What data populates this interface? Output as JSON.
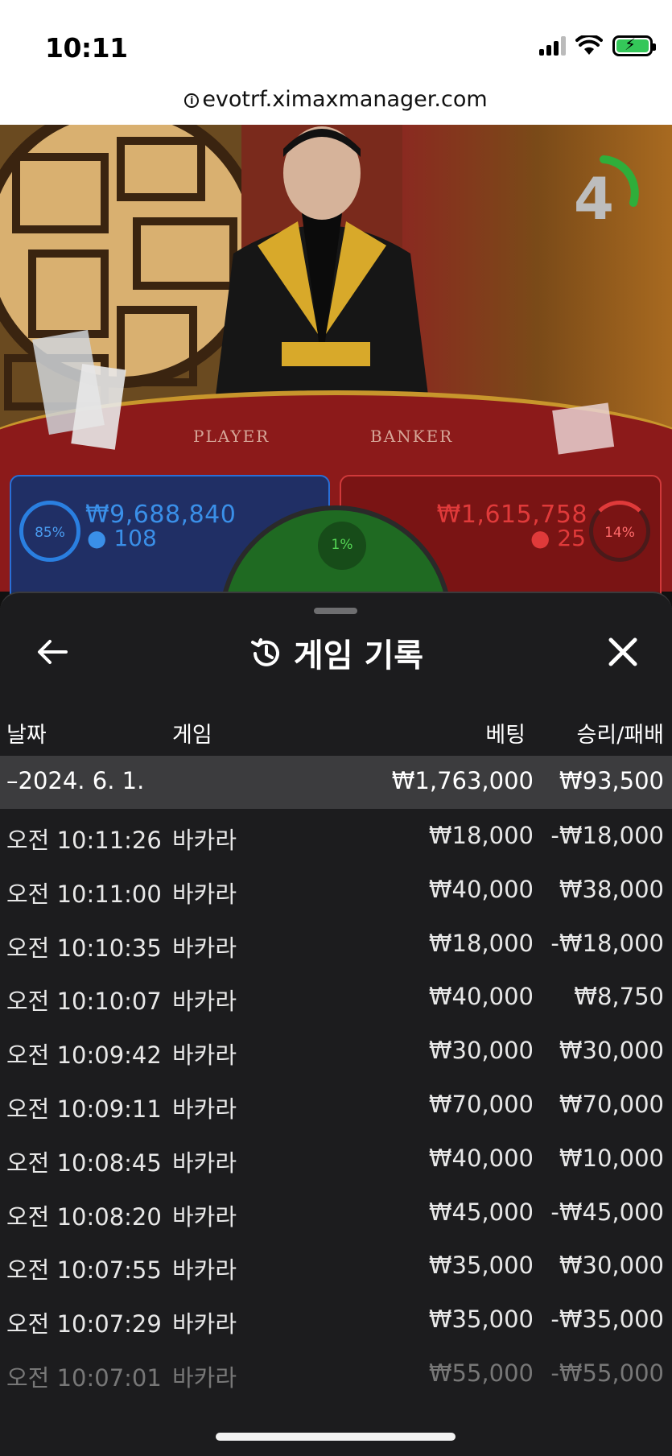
{
  "status_bar": {
    "time": "10:11"
  },
  "browser": {
    "url": "evotrf.ximaxmanager.com"
  },
  "video": {
    "countdown": "4",
    "table_labels": {
      "player": "PLAYER",
      "banker": "BANKER"
    },
    "player_bet": {
      "percent": "85%",
      "amount": "₩9,688,840",
      "players": "108"
    },
    "banker_bet": {
      "percent": "14%",
      "amount": "₩1,615,758",
      "players": "25"
    },
    "tie_bet": {
      "percent": "1%"
    }
  },
  "history": {
    "title": "게임 기록",
    "columns": {
      "date": "날짜",
      "game": "게임",
      "bet": "베팅",
      "win_loss": "승리/패배"
    },
    "summary": {
      "date": "–2024. 6. 1.",
      "bet": "₩1,763,000",
      "win_loss": "₩93,500"
    },
    "rows": [
      {
        "time": "오전 10:11:26",
        "game": "바카라",
        "bet": "₩18,000",
        "win_loss": "-₩18,000"
      },
      {
        "time": "오전 10:11:00",
        "game": "바카라",
        "bet": "₩40,000",
        "win_loss": "₩38,000"
      },
      {
        "time": "오전 10:10:35",
        "game": "바카라",
        "bet": "₩18,000",
        "win_loss": "-₩18,000"
      },
      {
        "time": "오전 10:10:07",
        "game": "바카라",
        "bet": "₩40,000",
        "win_loss": "₩8,750"
      },
      {
        "time": "오전 10:09:42",
        "game": "바카라",
        "bet": "₩30,000",
        "win_loss": "₩30,000"
      },
      {
        "time": "오전 10:09:11",
        "game": "바카라",
        "bet": "₩70,000",
        "win_loss": "₩70,000"
      },
      {
        "time": "오전 10:08:45",
        "game": "바카라",
        "bet": "₩40,000",
        "win_loss": "₩10,000"
      },
      {
        "time": "오전 10:08:20",
        "game": "바카라",
        "bet": "₩45,000",
        "win_loss": "-₩45,000"
      },
      {
        "time": "오전 10:07:55",
        "game": "바카라",
        "bet": "₩35,000",
        "win_loss": "₩30,000"
      },
      {
        "time": "오전 10:07:29",
        "game": "바카라",
        "bet": "₩35,000",
        "win_loss": "-₩35,000"
      },
      {
        "time": "오전 10:07:01",
        "game": "바카라",
        "bet": "₩55,000",
        "win_loss": "-₩55,000"
      }
    ]
  },
  "colors": {
    "player_blue": "#2a7fe0",
    "banker_red": "#d0393a",
    "tie_green": "#2fae3a",
    "panel_bg": "#1c1c1e"
  },
  "icons": {
    "back": "arrow-left-icon",
    "history": "history-icon",
    "close": "close-icon"
  }
}
